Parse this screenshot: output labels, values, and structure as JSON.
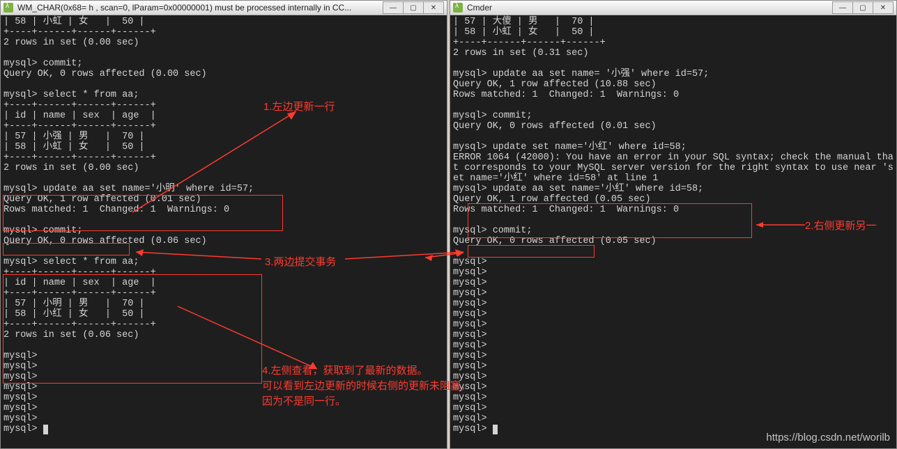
{
  "left": {
    "title": "WM_CHAR(0x68= h , scan=0, lParam=0x00000001) must be processed internally in CC...",
    "lines": [
      "| 58 | 小虹 | 女   |  50 |",
      "+----+------+------+------+",
      "2 rows in set (0.00 sec)",
      "",
      "mysql> commit;",
      "Query OK, 0 rows affected (0.00 sec)",
      "",
      "mysql> select * from aa;",
      "+----+------+------+------+",
      "| id | name | sex  | age  |",
      "+----+------+------+------+",
      "| 57 | 小强 | 男   |  70 |",
      "| 58 | 小虹 | 女   |  50 |",
      "+----+------+------+------+",
      "2 rows in set (0.00 sec)",
      "",
      "mysql> update aa set name='小明' where id=57;",
      "Query OK, 1 row affected (0.01 sec)",
      "Rows matched: 1  Changed: 1  Warnings: 0",
      "",
      "mysql> commit;",
      "Query OK, 0 rows affected (0.06 sec)",
      "",
      "mysql> select * from aa;",
      "+----+------+------+------+",
      "| id | name | sex  | age  |",
      "+----+------+------+------+",
      "| 57 | 小明 | 男   |  70 |",
      "| 58 | 小红 | 女   |  50 |",
      "+----+------+------+------+",
      "2 rows in set (0.06 sec)",
      "",
      "mysql>",
      "mysql>",
      "mysql>",
      "mysql>",
      "mysql>",
      "mysql>",
      "mysql>",
      "mysql> "
    ]
  },
  "right": {
    "title": "Cmder",
    "lines": [
      "| 57 | 大傻 | 男   |  70 |",
      "| 58 | 小虹 | 女   |  50 |",
      "+----+------+------+------+",
      "2 rows in set (0.31 sec)",
      "",
      "mysql> update aa set name= '小强' where id=57;",
      "Query OK, 1 row affected (10.88 sec)",
      "Rows matched: 1  Changed: 1  Warnings: 0",
      "",
      "mysql> commit;",
      "Query OK, 0 rows affected (0.01 sec)",
      "",
      "mysql> update set name='小红' where id=58;",
      "ERROR 1064 (42000): You have an error in your SQL syntax; check the manual tha",
      "t corresponds to your MySQL server version for the right syntax to use near 's",
      "et name='小红' where id=58' at line 1",
      "mysql> update aa set name='小红' where id=58;",
      "Query OK, 1 row affected (0.05 sec)",
      "Rows matched: 1  Changed: 1  Warnings: 0",
      "",
      "mysql> commit;",
      "Query OK, 0 rows affected (0.05 sec)",
      "",
      "mysql>",
      "mysql>",
      "mysql>",
      "mysql>",
      "mysql>",
      "mysql>",
      "mysql>",
      "mysql>",
      "mysql>",
      "mysql>",
      "mysql>",
      "mysql>",
      "mysql>",
      "mysql>",
      "mysql>",
      "mysql>",
      "mysql> "
    ]
  },
  "annotations": {
    "a1": "1.左边更新一行",
    "a2": "2.右侧更新另一",
    "a3": "3.两边提交事务",
    "a4": "4.左侧查看，获取到了最新的数据。\n可以看到左边更新的时候右侧的更新未阻塞，\n因为不是同一行。"
  },
  "watermark": "https://blog.csdn.net/worilb",
  "winbuttons": {
    "min": "—",
    "max": "▢",
    "close": "✕"
  }
}
